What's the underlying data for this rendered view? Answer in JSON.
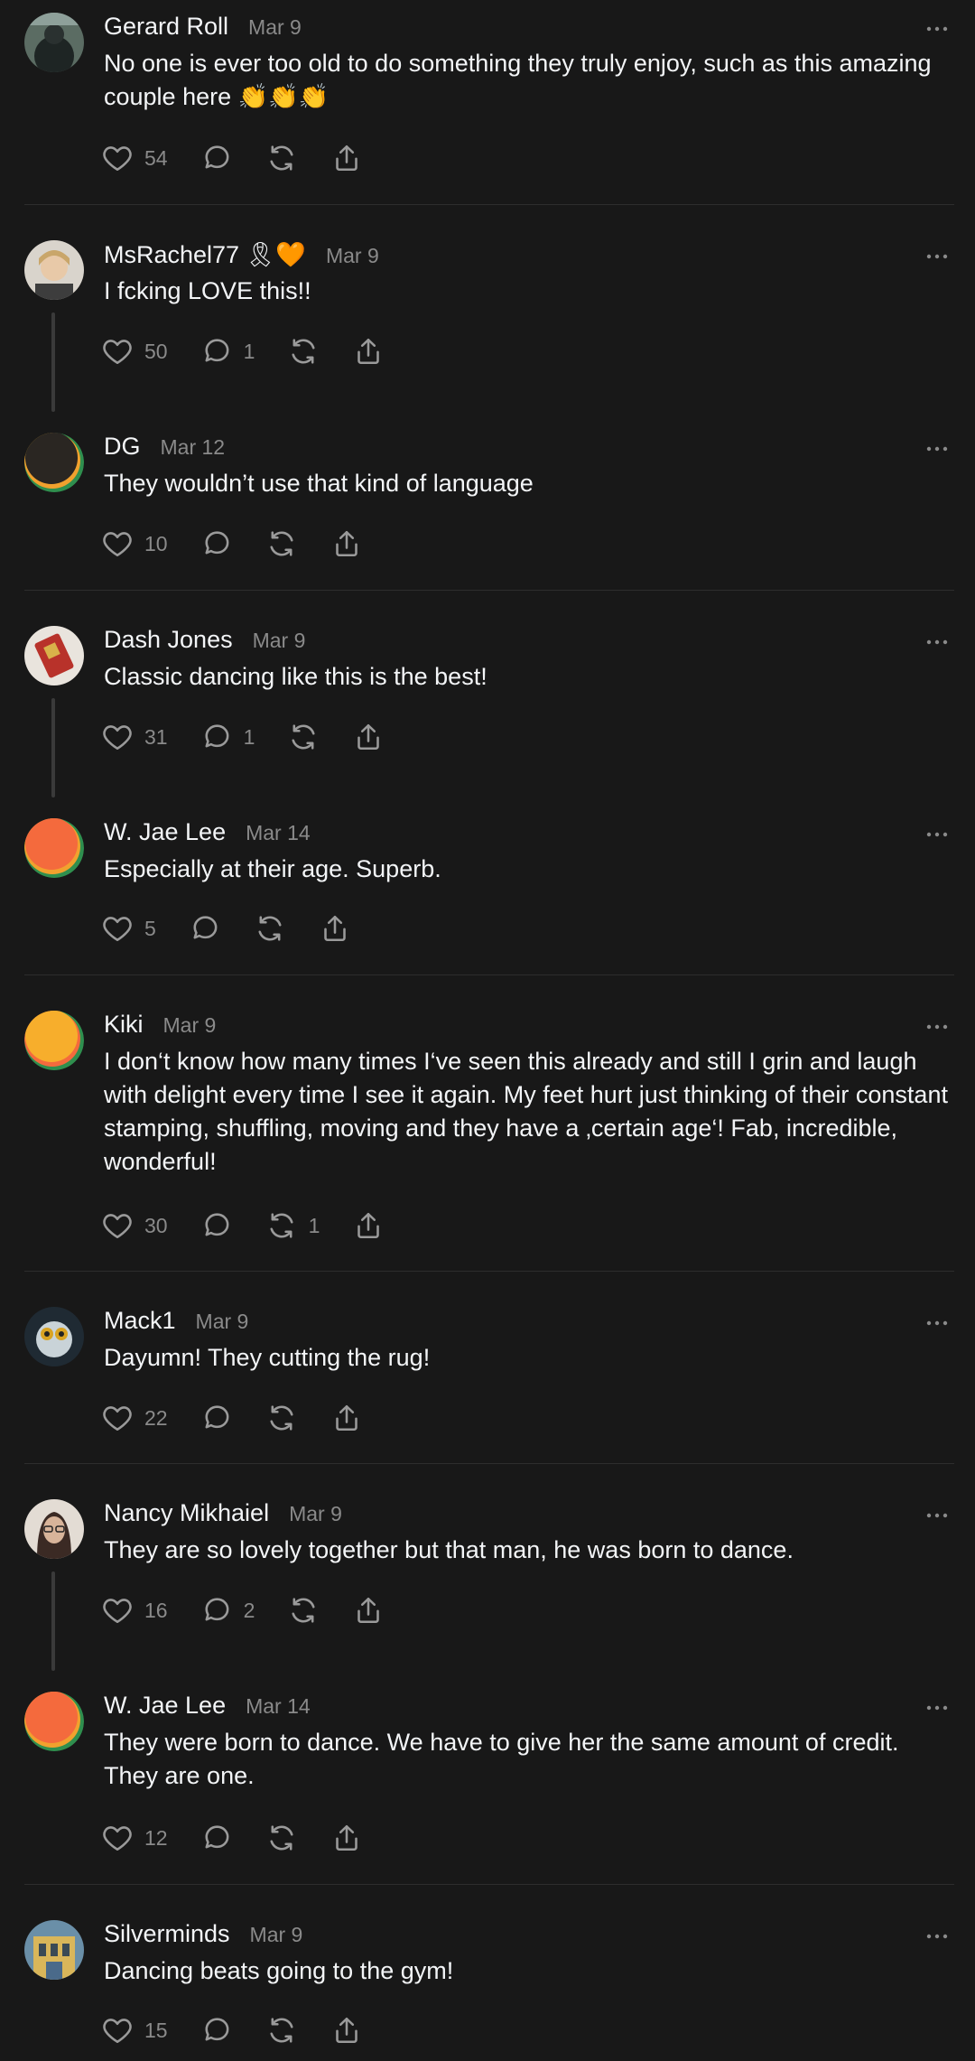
{
  "posts": [
    {
      "name": "Gerard Roll",
      "badge": "",
      "date": "Mar 9",
      "text": "No one is ever too old to do something they truly enjoy, such as this amazing couple here 👏👏👏",
      "likes": "54",
      "replies": "",
      "reposts": ""
    },
    {
      "name": "MsRachel77",
      "badge": "🎗🧡",
      "date": "Mar 9",
      "text": "I fcking LOVE this!!",
      "likes": "50",
      "replies": "1",
      "reposts": ""
    },
    {
      "name": "DG",
      "badge": "",
      "date": "Mar 12",
      "text": "They wouldn’t use that kind of language",
      "likes": "10",
      "replies": "",
      "reposts": ""
    },
    {
      "name": "Dash Jones",
      "badge": "",
      "date": "Mar 9",
      "text": "Classic dancing like this is the best!",
      "likes": "31",
      "replies": "1",
      "reposts": ""
    },
    {
      "name": "W. Jae Lee",
      "badge": "",
      "date": "Mar 14",
      "text": "Especially at their age. Superb.",
      "likes": "5",
      "replies": "",
      "reposts": ""
    },
    {
      "name": "Kiki",
      "badge": "",
      "date": "Mar 9",
      "text": "I don‘t know how many times I‘ve seen this already and still I grin and laugh with delight every time I see it again. My feet hurt just thinking of their constant stamping, shuffling, moving and they have a ‚certain age‘! Fab, incredible, wonderful!",
      "likes": "30",
      "replies": "",
      "reposts": "1"
    },
    {
      "name": "Mack1",
      "badge": "",
      "date": "Mar 9",
      "text": "Dayumn! They cutting the rug!",
      "likes": "22",
      "replies": "",
      "reposts": ""
    },
    {
      "name": "Nancy Mikhaiel",
      "badge": "",
      "date": "Mar 9",
      "text": "They are so lovely together but that man, he was born to dance.",
      "likes": "16",
      "replies": "2",
      "reposts": ""
    },
    {
      "name": "W. Jae Lee",
      "badge": "",
      "date": "Mar 14",
      "text": "They were born to dance. We have to give her the same amount of credit. They are one.",
      "likes": "12",
      "replies": "",
      "reposts": ""
    },
    {
      "name": "Silverminds",
      "badge": "",
      "date": "Mar 9",
      "text": "Dancing beats going to the gym!",
      "likes": "15",
      "replies": "",
      "reposts": ""
    }
  ],
  "colors": {
    "background": "#181818",
    "text": "#f3f5f7",
    "muted": "#8a8a8a",
    "divider": "#2d2d2d"
  }
}
